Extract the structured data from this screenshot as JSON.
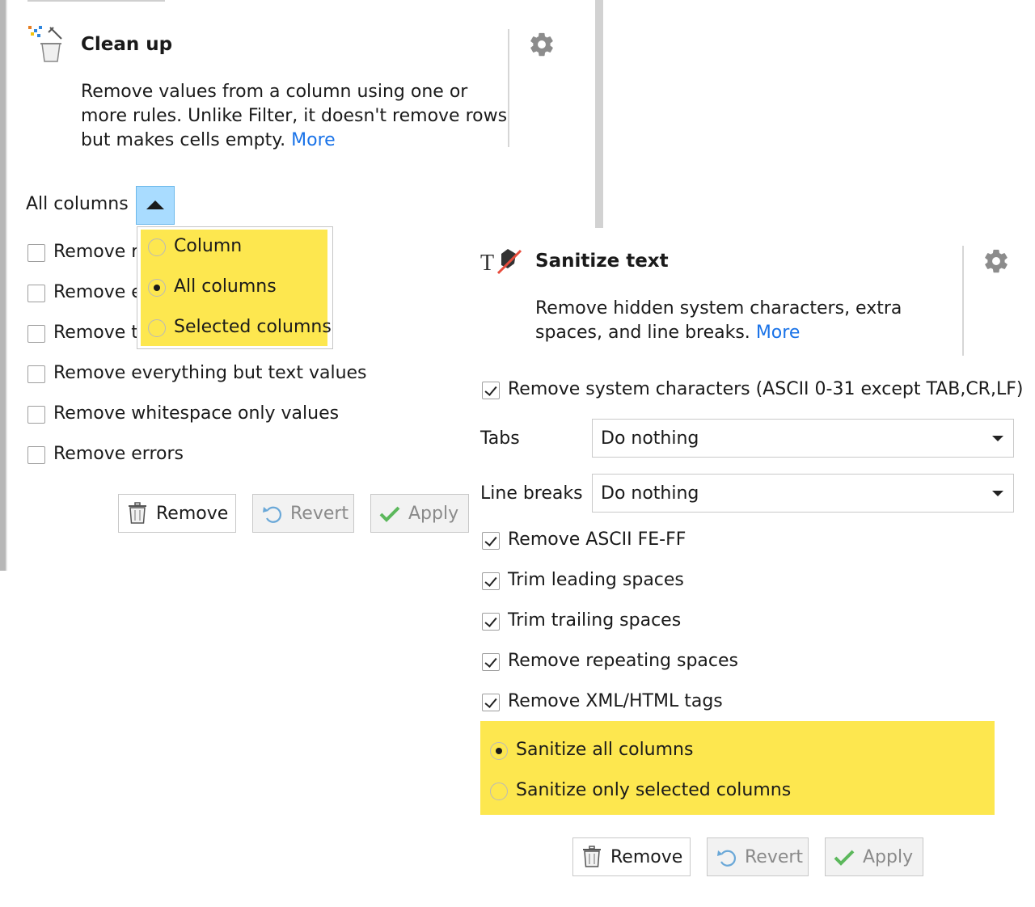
{
  "cleanup": {
    "title": "Clean up",
    "description": "Remove values from a column using one or more rules. Unlike Filter, it doesn't remove rows but makes cells empty.",
    "more_link": "More",
    "scope_label": "All columns",
    "scope_options": [
      {
        "label": "Column",
        "selected": false
      },
      {
        "label": "All columns",
        "selected": true
      },
      {
        "label": "Selected columns",
        "selected": false
      }
    ],
    "rules": [
      {
        "label": "Remove r",
        "checked": false
      },
      {
        "label": "Remove e",
        "checked": false
      },
      {
        "label": "Remove t",
        "checked": false
      },
      {
        "label": "Remove everything but text values",
        "checked": false
      },
      {
        "label": "Remove whitespace only values",
        "checked": false
      },
      {
        "label": "Remove errors",
        "checked": false
      }
    ],
    "buttons": {
      "remove": "Remove",
      "revert": "Revert",
      "apply": "Apply"
    }
  },
  "sanitize": {
    "title": "Sanitize text",
    "description": "Remove hidden system characters, extra spaces, and line breaks.",
    "more_link": "More",
    "system_chars": {
      "label": "Remove system characters (ASCII 0-31 except TAB,CR,LF)",
      "checked": true
    },
    "tabs": {
      "label": "Tabs",
      "value": "Do nothing"
    },
    "line_breaks": {
      "label": "Line breaks",
      "value": "Do nothing"
    },
    "options": [
      {
        "label": "Remove ASCII FE-FF",
        "checked": true
      },
      {
        "label": "Trim leading spaces",
        "checked": true
      },
      {
        "label": "Trim trailing spaces",
        "checked": true
      },
      {
        "label": "Remove repeating spaces",
        "checked": true
      },
      {
        "label": "Remove XML/HTML tags",
        "checked": true
      }
    ],
    "scope_options": [
      {
        "label": "Sanitize all columns",
        "selected": true
      },
      {
        "label": "Sanitize only selected columns",
        "selected": false
      }
    ],
    "buttons": {
      "remove": "Remove",
      "revert": "Revert",
      "apply": "Apply"
    }
  },
  "colors": {
    "highlight": "#fde74f",
    "link": "#1a73e8",
    "scope_button": "#a9dcff"
  }
}
